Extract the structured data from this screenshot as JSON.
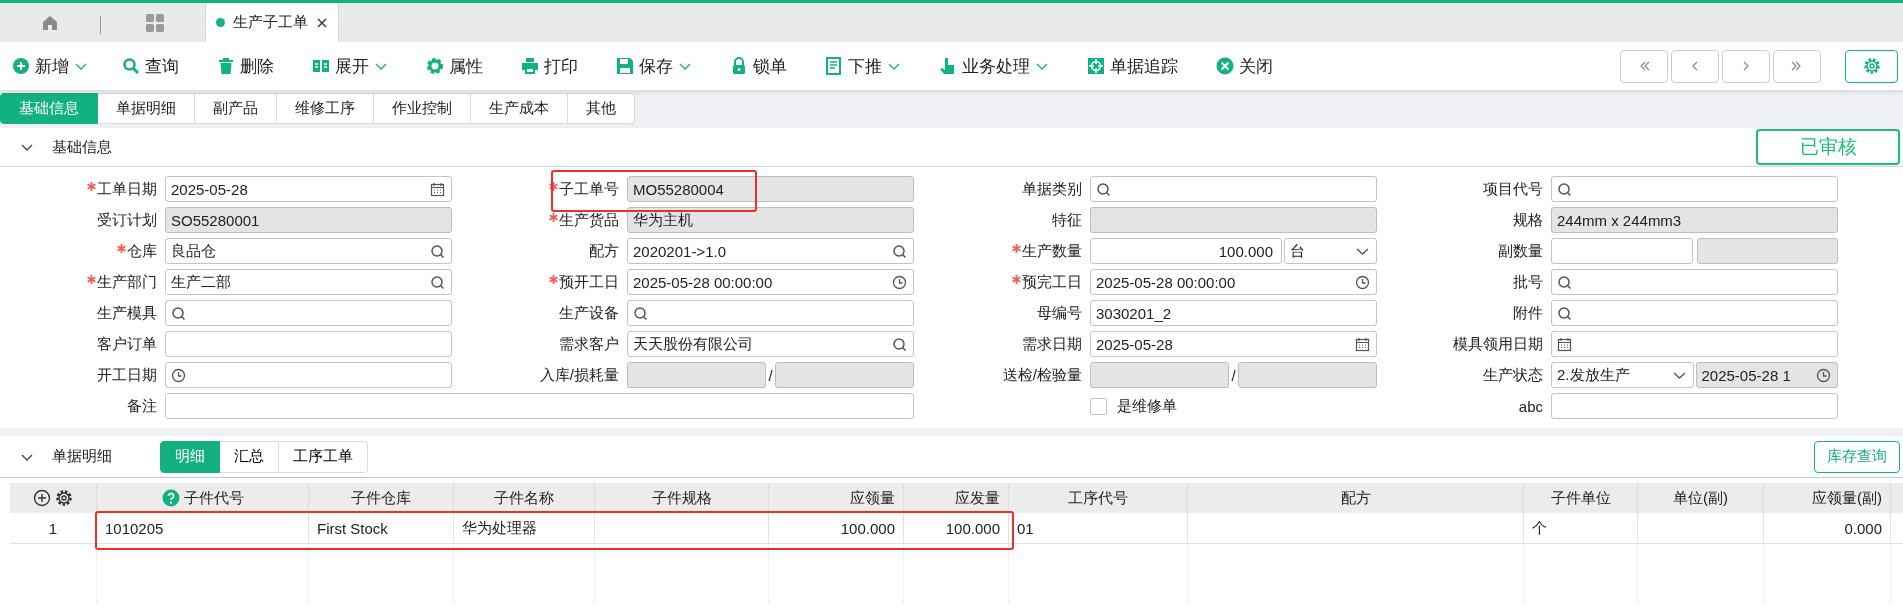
{
  "page_tabs": [
    {
      "kind": "home",
      "selected": false
    },
    {
      "kind": "grid",
      "selected": false
    },
    {
      "kind": "document",
      "label": "生产子工单",
      "selected": true
    }
  ],
  "toolbar": [
    {
      "label": "新增",
      "dropdown": true
    },
    {
      "label": "查询",
      "dropdown": false
    },
    {
      "label": "删除",
      "dropdown": false
    },
    {
      "label": "展开",
      "dropdown": true
    },
    {
      "label": "属性",
      "dropdown": false
    },
    {
      "label": "打印",
      "dropdown": false
    },
    {
      "label": "保存",
      "dropdown": true
    },
    {
      "label": "锁单",
      "dropdown": false
    },
    {
      "label": "下推",
      "dropdown": true
    },
    {
      "label": "业务处理",
      "dropdown": true
    },
    {
      "label": "单据追踪",
      "dropdown": false
    },
    {
      "label": "关闭",
      "dropdown": false
    }
  ],
  "form_tabs": [
    {
      "label": "基础信息",
      "selected": true
    },
    {
      "label": "单据明细",
      "selected": false
    },
    {
      "label": "副产品",
      "selected": false
    },
    {
      "label": "维修工序",
      "selected": false
    },
    {
      "label": "作业控制",
      "selected": false
    },
    {
      "label": "生产成本",
      "selected": false
    },
    {
      "label": "其他",
      "selected": false
    }
  ],
  "basic_section": {
    "title": "基础信息",
    "expanded": true,
    "status_stamp": "已审核"
  },
  "fields": [
    {
      "label": "工单日期",
      "required": true,
      "kind": "date",
      "value": "2025-05-28",
      "readonly": false
    },
    {
      "label": "子工单号",
      "required": true,
      "kind": "text",
      "value": "MO55280004",
      "readonly": true,
      "highlighted": true
    },
    {
      "label": "单据类别",
      "required": false,
      "kind": "search",
      "readonly": false
    },
    {
      "label": "项目代号",
      "required": false,
      "kind": "search",
      "readonly": false
    },
    {
      "label": "受订计划",
      "required": false,
      "kind": "text",
      "value": "SO55280001",
      "readonly": true
    },
    {
      "label": "生产货品",
      "required": true,
      "kind": "text",
      "value": "华为主机",
      "readonly": true
    },
    {
      "label": "特征",
      "required": false,
      "kind": "text",
      "readonly": true
    },
    {
      "label": "规格",
      "required": false,
      "kind": "text",
      "value": "244mm x 244mm3",
      "readonly": true
    },
    {
      "label": "仓库",
      "required": true,
      "kind": "search",
      "value": "良品仓",
      "readonly": false
    },
    {
      "label": "配方",
      "required": false,
      "kind": "search",
      "value": "2020201->1.0",
      "readonly": false
    },
    {
      "label": "生产数量",
      "required": true,
      "kind": "quantity",
      "value": "100.000",
      "unit": "台",
      "readonly": false
    },
    {
      "label": "副数量",
      "required": false,
      "kind": "pair",
      "parts": [
        {
          "readonly": false
        },
        {
          "readonly": true
        }
      ]
    },
    {
      "label": "生产部门",
      "required": true,
      "kind": "search",
      "value": "生产二部",
      "readonly": false
    },
    {
      "label": "预开工日",
      "required": true,
      "kind": "time",
      "value": "2025-05-28 00:00:00",
      "readonly": false
    },
    {
      "label": "预完工日",
      "required": true,
      "kind": "time",
      "value": "2025-05-28 00:00:00",
      "readonly": false
    },
    {
      "label": "批号",
      "required": false,
      "kind": "search",
      "readonly": false
    },
    {
      "label": "生产模具",
      "required": false,
      "kind": "search",
      "readonly": false
    },
    {
      "label": "生产设备",
      "required": false,
      "kind": "search",
      "readonly": false
    },
    {
      "label": "母编号",
      "required": false,
      "kind": "text",
      "value": "3030201_2",
      "readonly": false
    },
    {
      "label": "附件",
      "required": false,
      "kind": "search",
      "readonly": false
    },
    {
      "label": "客户订单",
      "required": false,
      "kind": "text",
      "readonly": false
    },
    {
      "label": "需求客户",
      "required": false,
      "kind": "search",
      "value": "天天股份有限公司",
      "readonly": false
    },
    {
      "label": "需求日期",
      "required": false,
      "kind": "date",
      "value": "2025-05-28",
      "readonly": false
    },
    {
      "label": "模具领用日期",
      "required": false,
      "kind": "date",
      "readonly": false
    },
    {
      "label": "开工日期",
      "required": false,
      "kind": "time",
      "readonly": false
    },
    {
      "label": "入库/损耗量",
      "required": false,
      "kind": "pair",
      "separator": "/",
      "parts": [
        {
          "readonly": true
        },
        {
          "readonly": true
        }
      ]
    },
    {
      "label": "送检/检验量",
      "required": false,
      "kind": "pair",
      "separator": "/",
      "parts": [
        {
          "readonly": true
        },
        {
          "readonly": true
        }
      ]
    },
    {
      "label": "生产状态",
      "required": false,
      "kind": "status",
      "value": "2.发放生产",
      "time": "2025-05-28 1",
      "readonly": false
    },
    {
      "label": "备注",
      "required": false,
      "kind": "wide_text",
      "readonly": false
    },
    {
      "kind": "checkbox",
      "text": "是维修单",
      "checked": false
    },
    {
      "label": "abc",
      "required": false,
      "kind": "text",
      "readonly": false
    }
  ],
  "detail_section": {
    "title": "单据明细",
    "expanded": true,
    "tabs": [
      {
        "label": "明细",
        "selected": true
      },
      {
        "label": "汇总",
        "selected": false
      },
      {
        "label": "工序工单",
        "selected": false
      }
    ],
    "button": "库存查询"
  },
  "table": {
    "columns": [
      {
        "label": "子件代号",
        "help": true,
        "kind": "text"
      },
      {
        "label": "子件仓库",
        "kind": "text"
      },
      {
        "label": "子件名称",
        "kind": "text"
      },
      {
        "label": "子件规格",
        "kind": "text"
      },
      {
        "label": "应领量",
        "kind": "number"
      },
      {
        "label": "应发量",
        "kind": "number"
      },
      {
        "label": "工序代号",
        "kind": "text"
      },
      {
        "label": "配方",
        "kind": "text"
      },
      {
        "label": "子件单位",
        "kind": "text"
      },
      {
        "label": "单位(副)",
        "kind": "text"
      },
      {
        "label": "应领量(副)",
        "kind": "number"
      }
    ],
    "rows": [
      {
        "number": "1",
        "cells": [
          {
            "text": "1010205"
          },
          {
            "text": "First Stock"
          },
          {
            "text": "华为处理器"
          },
          {},
          {
            "text": "100.000"
          },
          {
            "text": "100.000"
          },
          {
            "text": "01"
          },
          {},
          {
            "text": "个"
          },
          {},
          {
            "text": "0.000"
          }
        ],
        "highlighted": true
      }
    ]
  }
}
